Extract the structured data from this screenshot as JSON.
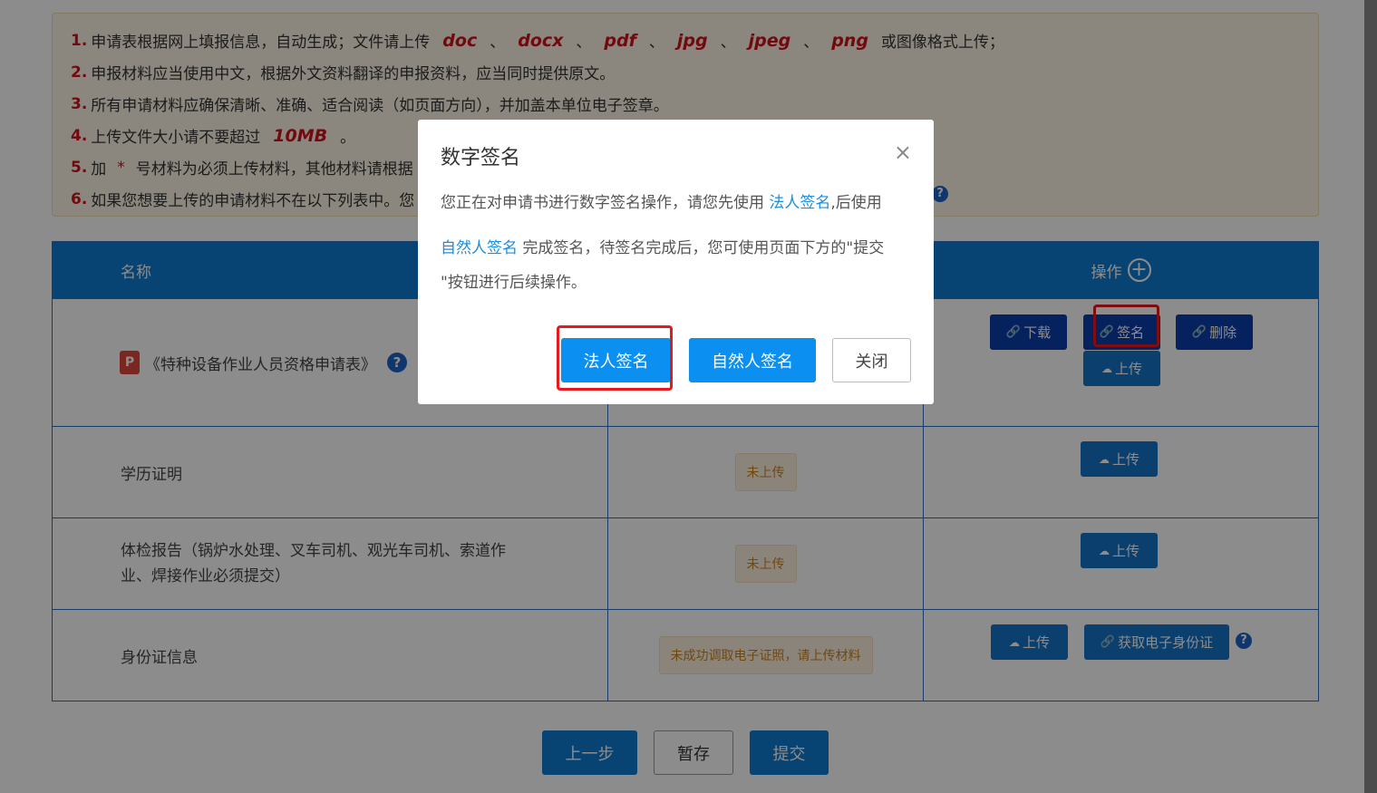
{
  "notice": {
    "line1": {
      "num": "1.",
      "text_pre": "申请表根据网上填报信息，自动生成；文件请上传",
      "formats": [
        "doc",
        "docx",
        "pdf",
        "jpg",
        "jpeg",
        "png"
      ],
      "sep": "、",
      "text_post": "或图像格式上传；"
    },
    "line2": {
      "num": "2.",
      "text": "申报材料应当使用中文，根据外文资料翻译的申报资料，应当同时提供原文。"
    },
    "line3": {
      "num": "3.",
      "text": "所有申请材料应确保清晰、准确、适合阅读（如页面方向），并加盖本单位电子签章。"
    },
    "line4": {
      "num": "4.",
      "text_pre": "上传文件大小请不要超过",
      "size": "10MB",
      "text_post": "。"
    },
    "line5": {
      "num": "5.",
      "text_pre": "加",
      "star": "*",
      "text_post": "号材料为必须上传材料，其他材料请根据"
    },
    "line6": {
      "num": "6.",
      "text": "如果您想要上传的申请材料不在以下列表中。您"
    },
    "help_icon": "?"
  },
  "table": {
    "headers": {
      "name": "名称",
      "operation": "操作",
      "add_icon": "+"
    },
    "rows": [
      {
        "name": "《特种设备作业人员资格申请表》",
        "file_icon": "P",
        "help": "?",
        "buttons": {
          "download": "下载",
          "sign": "签名",
          "delete": "删除",
          "upload": "上传"
        }
      },
      {
        "name": "学历证明",
        "status": "未上传",
        "buttons": {
          "upload": "上传"
        }
      },
      {
        "name_line1": "体检报告（锅炉水处理、叉车司机、观光车司机、索道作",
        "name_line2": "业、焊接作业必须提交）",
        "status": "未上传",
        "buttons": {
          "upload": "上传"
        }
      },
      {
        "name": "身份证信息",
        "status": "未成功调取电子证照，请上传材料",
        "buttons": {
          "upload": "上传",
          "get_id": "获取电子身份证"
        },
        "help": "?"
      }
    ]
  },
  "bottom": {
    "prev": "上一步",
    "save": "暂存",
    "submit": "提交"
  },
  "modal": {
    "title": "数字签名",
    "close": "×",
    "body": {
      "p1_pre": "您正在对申请书进行数字签名操作，请您先使用 ",
      "link_legal": "法人签名",
      "p1_post": ",后使用",
      "link_natural": "自然人签名",
      "p2_post": " 完成签名，待签名完成后，您可使用页面下方的\"提交",
      "p3": "\"按钮进行后续操作。"
    },
    "buttons": {
      "legal": "法人签名",
      "natural": "自然人签名",
      "close": "关闭"
    }
  },
  "icons": {
    "link": "🔗",
    "cloud": "☁"
  },
  "colors": {
    "header_blue": "#0e7dd3",
    "dark_btn": "#0a3fae",
    "red_highlight": "#e8191c",
    "modal_btn": "#0b90f2"
  }
}
